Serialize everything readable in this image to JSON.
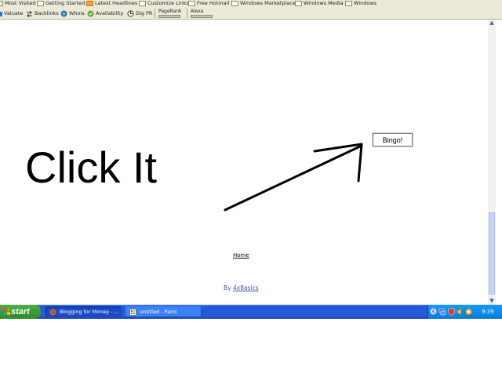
{
  "bookmarks_toolbar": {
    "items": [
      {
        "label": "Most Visited"
      },
      {
        "label": "Getting Started"
      },
      {
        "label": "Latest Headlines"
      },
      {
        "label": "Customize Links"
      },
      {
        "label": "Free Hotmail"
      },
      {
        "label": "Windows Marketplace"
      },
      {
        "label": "Windows Media"
      },
      {
        "label": "Windows"
      }
    ]
  },
  "seo_toolbar": {
    "items": [
      {
        "label": "Valuate"
      },
      {
        "label": "Backlinks"
      },
      {
        "label": "Whois"
      },
      {
        "label": "Availability"
      },
      {
        "label": "Dig PR"
      }
    ],
    "pagerank_label": "PageRank",
    "alexa_label": "Alexa"
  },
  "page": {
    "headline": "Click It",
    "button_label": "Bingo!",
    "home_link": "Home",
    "by_prefix": "By",
    "author_link": "4x8asics"
  },
  "taskbar": {
    "start_label": "start",
    "tasks": [
      {
        "label": "Blogging for Money - ...",
        "icon": "firefox-icon",
        "active": true
      },
      {
        "label": "untitled - Paint",
        "icon": "paint-icon",
        "active": false
      }
    ],
    "clock": "9:39 PM"
  },
  "colors": {
    "taskbar_blue": "#245bd8",
    "start_green": "#3c9a36",
    "tray_blue": "#0e8cec",
    "toolbar_bg": "#ece9d8",
    "link_blue": "#3a56a0"
  }
}
